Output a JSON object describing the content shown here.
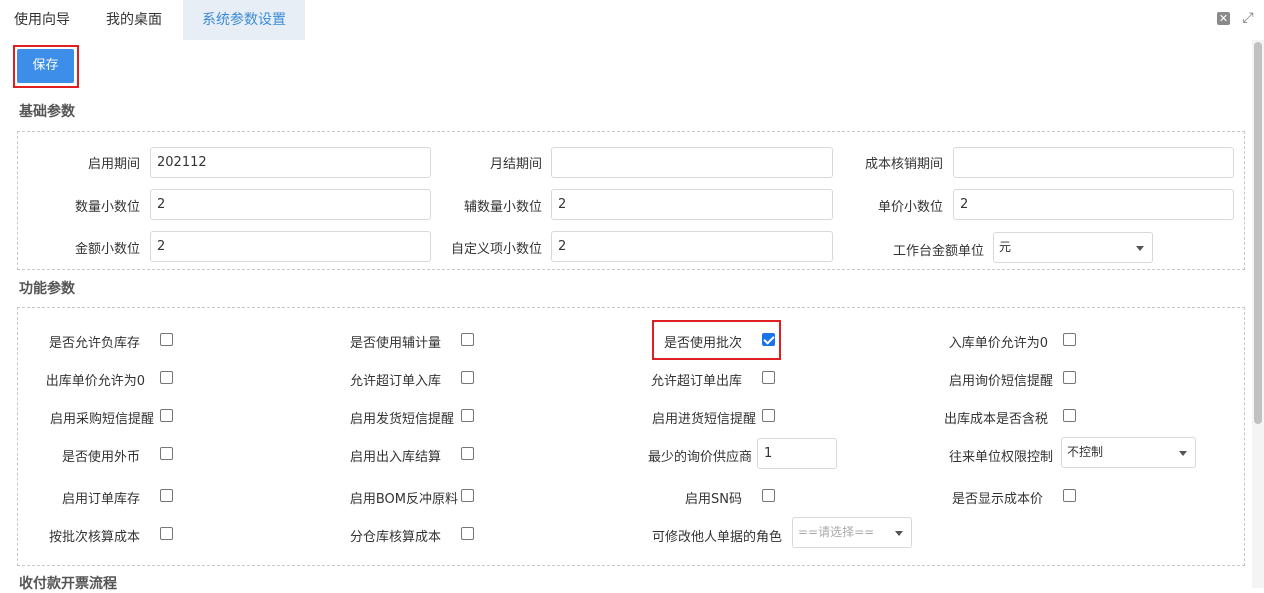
{
  "tabs": [
    {
      "label": "使用向导"
    },
    {
      "label": "我的桌面"
    },
    {
      "label": "系统参数设置"
    }
  ],
  "toolbar": {
    "save_label": "保存"
  },
  "basic": {
    "title": "基础参数",
    "start_period_label": "启用期间",
    "start_period_value": "202112",
    "month_close_label": "月结期间",
    "month_close_value": "",
    "cost_write_off_label": "成本核销期间",
    "cost_write_off_value": "",
    "qty_decimals_label": "数量小数位",
    "qty_decimals_value": "2",
    "aux_qty_decimals_label": "辅数量小数位",
    "aux_qty_decimals_value": "2",
    "unit_price_decimals_label": "单价小数位",
    "unit_price_decimals_value": "2",
    "amount_decimals_label": "金额小数位",
    "amount_decimals_value": "2",
    "custom_decimals_label": "自定义项小数位",
    "custom_decimals_value": "2",
    "workbench_unit_label": "工作台金额单位",
    "workbench_unit_value": "元"
  },
  "func": {
    "title": "功能参数",
    "allow_negative_stock": {
      "label": "是否允许负库存",
      "checked": false
    },
    "use_aux_qty": {
      "label": "是否使用辅计量",
      "checked": false
    },
    "use_batch": {
      "label": "是否使用批次",
      "checked": true
    },
    "inbound_price_zero": {
      "label": "入库单价允许为0",
      "checked": false
    },
    "outbound_price_zero": {
      "label": "出库单价允许为0",
      "checked": false
    },
    "allow_over_order_in": {
      "label": "允许超订单入库",
      "checked": false
    },
    "allow_over_order_out": {
      "label": "允许超订单出库",
      "checked": false
    },
    "enable_inquiry_sms": {
      "label": "启用询价短信提醒",
      "checked": false
    },
    "enable_purchase_sms": {
      "label": "启用采购短信提醒",
      "checked": false
    },
    "enable_delivery_sms": {
      "label": "启用发货短信提醒",
      "checked": false
    },
    "enable_receipt_sms": {
      "label": "启用进货短信提醒",
      "checked": false
    },
    "outbound_cost_tax": {
      "label": "出库成本是否含税",
      "checked": false
    },
    "use_foreign_currency": {
      "label": "是否使用外币",
      "checked": false
    },
    "enable_io_settlement": {
      "label": "启用出入库结算",
      "checked": false
    },
    "min_inquiry_suppliers": {
      "label": "最少的询价供应商",
      "value": "1"
    },
    "partner_permission": {
      "label": "往来单位权限控制",
      "value": "不控制"
    },
    "enable_order_stock": {
      "label": "启用订单库存",
      "checked": false
    },
    "enable_bom_backflush": {
      "label": "启用BOM反冲原料",
      "checked": false
    },
    "enable_sn": {
      "label": "启用SN码",
      "checked": false
    },
    "show_cost_price": {
      "label": "是否显示成本价",
      "checked": false
    },
    "batch_costing": {
      "label": "按批次核算成本",
      "checked": false
    },
    "warehouse_costing": {
      "label": "分仓库核算成本",
      "checked": false
    },
    "edit_others_role": {
      "label": "可修改他人单据的角色",
      "placeholder": "==请选择=="
    }
  },
  "payment": {
    "title": "收付款开票流程"
  },
  "colors": {
    "accent": "#3c8ee8",
    "highlight": "#e02020",
    "checkbox_checked": "#1a73e8"
  }
}
